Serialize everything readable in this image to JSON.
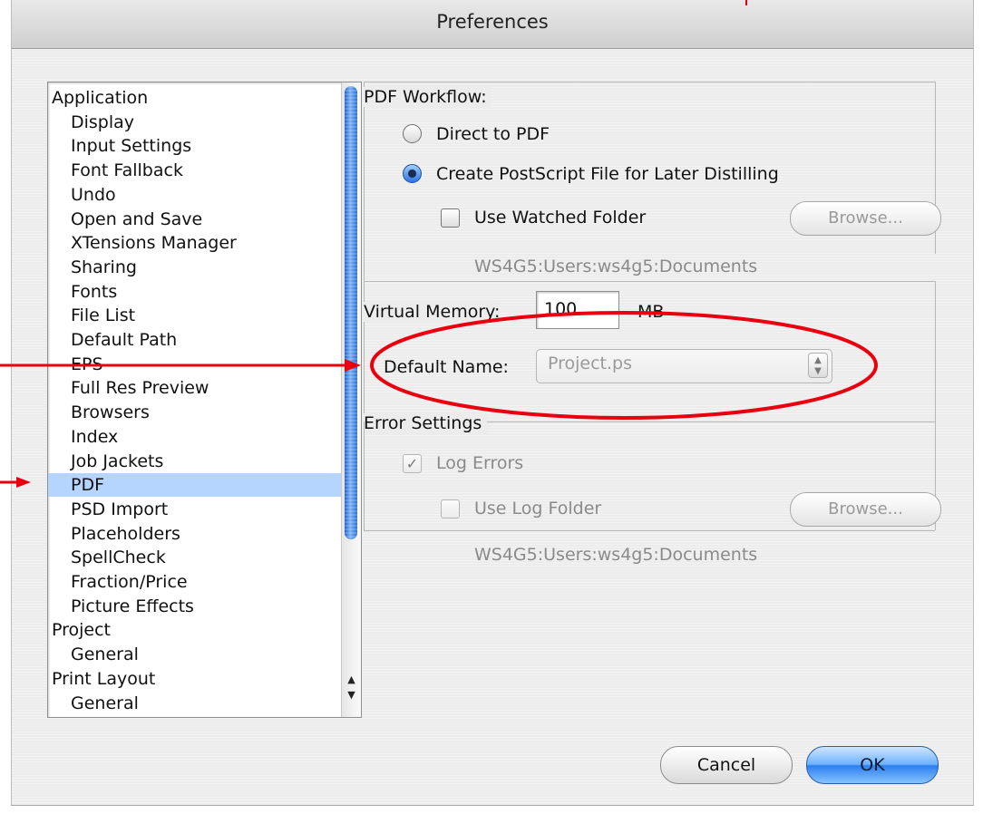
{
  "window": {
    "title": "Preferences"
  },
  "sidebar": {
    "items": [
      {
        "label": "Application",
        "level": 0
      },
      {
        "label": "Display",
        "level": 1
      },
      {
        "label": "Input Settings",
        "level": 1
      },
      {
        "label": "Font Fallback",
        "level": 1
      },
      {
        "label": "Undo",
        "level": 1
      },
      {
        "label": "Open and Save",
        "level": 1
      },
      {
        "label": "XTensions Manager",
        "level": 1
      },
      {
        "label": "Sharing",
        "level": 1
      },
      {
        "label": "Fonts",
        "level": 1
      },
      {
        "label": "File List",
        "level": 1
      },
      {
        "label": "Default Path",
        "level": 1
      },
      {
        "label": "EPS",
        "level": 1
      },
      {
        "label": "Full Res Preview",
        "level": 1
      },
      {
        "label": "Browsers",
        "level": 1
      },
      {
        "label": "Index",
        "level": 1
      },
      {
        "label": "Job Jackets",
        "level": 1
      },
      {
        "label": "PDF",
        "level": 1,
        "selected": true
      },
      {
        "label": "PSD Import",
        "level": 1
      },
      {
        "label": "Placeholders",
        "level": 1
      },
      {
        "label": "SpellCheck",
        "level": 1
      },
      {
        "label": "Fraction/Price",
        "level": 1
      },
      {
        "label": "Picture Effects",
        "level": 1
      },
      {
        "label": "Project",
        "level": 0
      },
      {
        "label": "General",
        "level": 1
      },
      {
        "label": "Print Layout",
        "level": 0
      },
      {
        "label": "General",
        "level": 1
      }
    ]
  },
  "pdf_workflow": {
    "title": "PDF Workflow:",
    "direct_label": "Direct to PDF",
    "postscript_label": "Create PostScript File for Later Distilling",
    "selected_option": "postscript",
    "watched_folder_label": "Use Watched Folder",
    "watched_folder_checked": false,
    "browse_label": "Browse...",
    "path": "WS4G5:Users:ws4g5:Documents"
  },
  "virtual_memory": {
    "label": "Virtual Memory:",
    "value": "100",
    "unit": "MB"
  },
  "default_name": {
    "label": "Default Name:",
    "value": "Project.ps"
  },
  "error_settings": {
    "title": "Error Settings",
    "log_errors_label": "Log Errors",
    "log_errors_checked": true,
    "log_folder_label": "Use Log Folder",
    "log_folder_checked": false,
    "browse_label": "Browse...",
    "path": "WS4G5:Users:ws4g5:Documents"
  },
  "buttons": {
    "cancel": "Cancel",
    "ok": "OK"
  },
  "annotation_color": "#e8000f"
}
